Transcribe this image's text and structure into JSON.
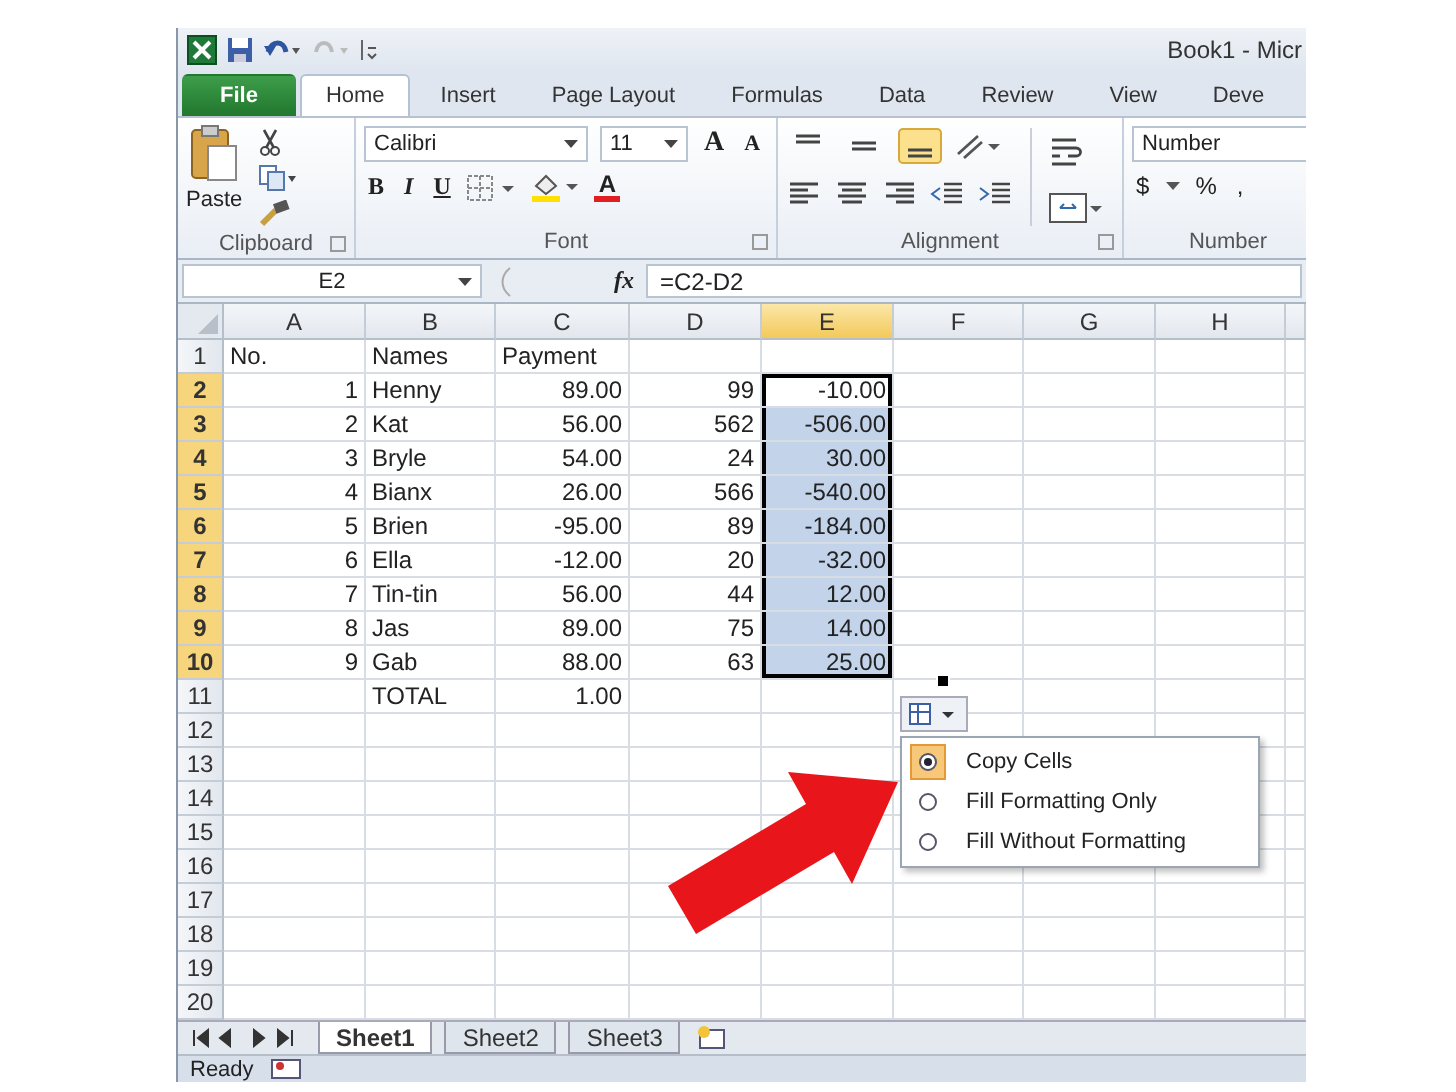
{
  "window": {
    "title": "Book1 - Micr"
  },
  "tabs": [
    {
      "label": "File",
      "kind": "file",
      "selected": false
    },
    {
      "label": "Home",
      "kind": "tab",
      "selected": true
    },
    {
      "label": "Insert",
      "kind": "tab",
      "selected": false
    },
    {
      "label": "Page Layout",
      "kind": "tab",
      "selected": false
    },
    {
      "label": "Formulas",
      "kind": "tab",
      "selected": false
    },
    {
      "label": "Data",
      "kind": "tab",
      "selected": false
    },
    {
      "label": "Review",
      "kind": "tab",
      "selected": false
    },
    {
      "label": "View",
      "kind": "tab",
      "selected": false
    },
    {
      "label": "Deve",
      "kind": "tab",
      "selected": false
    }
  ],
  "ribbon": {
    "clipboard": {
      "label": "Clipboard",
      "paste": "Paste"
    },
    "font": {
      "label": "Font",
      "font_name": "Calibri",
      "font_size": "11",
      "grow": "A",
      "shrink": "A",
      "bold": "B",
      "italic": "I",
      "underline": "U",
      "font_color": "A"
    },
    "alignment": {
      "label": "Alignment",
      "vertical": [
        {
          "selected": false
        },
        {
          "selected": false
        },
        {
          "selected": true
        }
      ]
    },
    "number": {
      "label": "Number",
      "format": "Number",
      "currency": "$",
      "percent": "%",
      "comma": ","
    }
  },
  "formula_bar": {
    "name_box": "E2",
    "fx": "fx",
    "formula": "=C2-D2"
  },
  "grid": {
    "columns": [
      {
        "label": "A",
        "selected": false
      },
      {
        "label": "B",
        "selected": false
      },
      {
        "label": "C",
        "selected": false
      },
      {
        "label": "D",
        "selected": false
      },
      {
        "label": "E",
        "selected": true
      },
      {
        "label": "F",
        "selected": false
      },
      {
        "label": "G",
        "selected": false
      },
      {
        "label": "H",
        "selected": false
      }
    ],
    "rows": [
      {
        "label": "1",
        "kind": "heading",
        "selected": false,
        "cells": {
          "a": "No.",
          "b": "Names",
          "c": "Payment"
        }
      },
      {
        "label": "2",
        "kind": "data",
        "selected": true,
        "cells": {
          "a": "1",
          "b": "Henny",
          "c": "89.00",
          "d": "99",
          "e": "-10.00"
        }
      },
      {
        "label": "3",
        "kind": "data",
        "selected": true,
        "cells": {
          "a": "2",
          "b": "Kat",
          "c": "56.00",
          "d": "562",
          "e": "-506.00"
        }
      },
      {
        "label": "4",
        "kind": "data",
        "selected": true,
        "cells": {
          "a": "3",
          "b": "Bryle",
          "c": "54.00",
          "d": "24",
          "e": "30.00"
        }
      },
      {
        "label": "5",
        "kind": "data",
        "selected": true,
        "cells": {
          "a": "4",
          "b": "Bianx",
          "c": "26.00",
          "d": "566",
          "e": "-540.00"
        }
      },
      {
        "label": "6",
        "kind": "data",
        "selected": true,
        "cells": {
          "a": "5",
          "b": "Brien",
          "c": "-95.00",
          "d": "89",
          "e": "-184.00"
        }
      },
      {
        "label": "7",
        "kind": "data",
        "selected": true,
        "cells": {
          "a": "6",
          "b": "Ella",
          "c": "-12.00",
          "d": "20",
          "e": "-32.00"
        }
      },
      {
        "label": "8",
        "kind": "data",
        "selected": true,
        "cells": {
          "a": "7",
          "b": "Tin-tin",
          "c": "56.00",
          "d": "44",
          "e": "12.00"
        }
      },
      {
        "label": "9",
        "kind": "data",
        "selected": true,
        "cells": {
          "a": "8",
          "b": "Jas",
          "c": "89.00",
          "d": "75",
          "e": "14.00"
        }
      },
      {
        "label": "10",
        "kind": "data",
        "selected": true,
        "cells": {
          "a": "9",
          "b": "Gab",
          "c": "88.00",
          "d": "63",
          "e": "25.00"
        }
      },
      {
        "label": "11",
        "kind": "data",
        "selected": false,
        "cells": {
          "b": "TOTAL",
          "c": "1.00"
        }
      },
      {
        "label": "12",
        "kind": "data",
        "selected": false,
        "cells": {}
      },
      {
        "label": "13",
        "kind": "data",
        "selected": false,
        "cells": {}
      },
      {
        "label": "14",
        "kind": "data",
        "selected": false,
        "cells": {}
      },
      {
        "label": "15",
        "kind": "data",
        "selected": false,
        "cells": {}
      },
      {
        "label": "16",
        "kind": "data",
        "selected": false,
        "cells": {}
      },
      {
        "label": "17",
        "kind": "data",
        "selected": false,
        "cells": {}
      },
      {
        "label": "18",
        "kind": "data",
        "selected": false,
        "cells": {}
      },
      {
        "label": "19",
        "kind": "data",
        "selected": false,
        "cells": {}
      },
      {
        "label": "20",
        "kind": "data",
        "selected": false,
        "cells": {}
      }
    ]
  },
  "paste_options": [
    {
      "label": "Copy Cells",
      "selected": true
    },
    {
      "label": "Fill Formatting Only",
      "selected": false
    },
    {
      "label": "Fill Without Formatting",
      "selected": false
    }
  ],
  "sheet_tabs": [
    {
      "label": "Sheet1",
      "selected": true
    },
    {
      "label": "Sheet2",
      "selected": false
    },
    {
      "label": "Sheet3",
      "selected": false
    }
  ],
  "status_bar": {
    "text": "Ready"
  }
}
